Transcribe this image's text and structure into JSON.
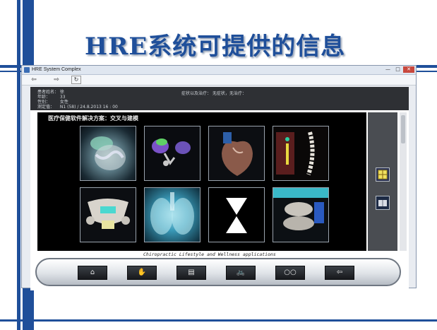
{
  "slide": {
    "title": "HRE系统可提供的信息"
  },
  "window": {
    "title": "HRE System Complex",
    "controls": {
      "minimize": "—",
      "maximize": "□",
      "close": "✕"
    }
  },
  "toolbar": {
    "back": "⇦",
    "forward": "⇨",
    "refresh": "↻"
  },
  "patient": {
    "name_label": "患者姓名：",
    "name_value": "徐",
    "age_label": "年龄：",
    "age_value": "33",
    "gender_label": "性别：",
    "gender_value": "女性",
    "test_label": "测定值：",
    "test_value": "N1 (58)  / 24.8.2013  16 : 00",
    "symptoms_text": "症状以及治疗：  无症状，无治疗："
  },
  "content": {
    "title": "医疗保健软件解决方案：交叉与建模"
  },
  "footer": {
    "caption": "Chiropractic Lifestyle and Wellness applications"
  },
  "dock": {
    "buttons": [
      "⌂",
      "✋",
      "▤",
      "🚲",
      "○○",
      "⇦"
    ]
  },
  "icons": {
    "side_top": "target-icon",
    "side_bottom": "book-icon"
  }
}
